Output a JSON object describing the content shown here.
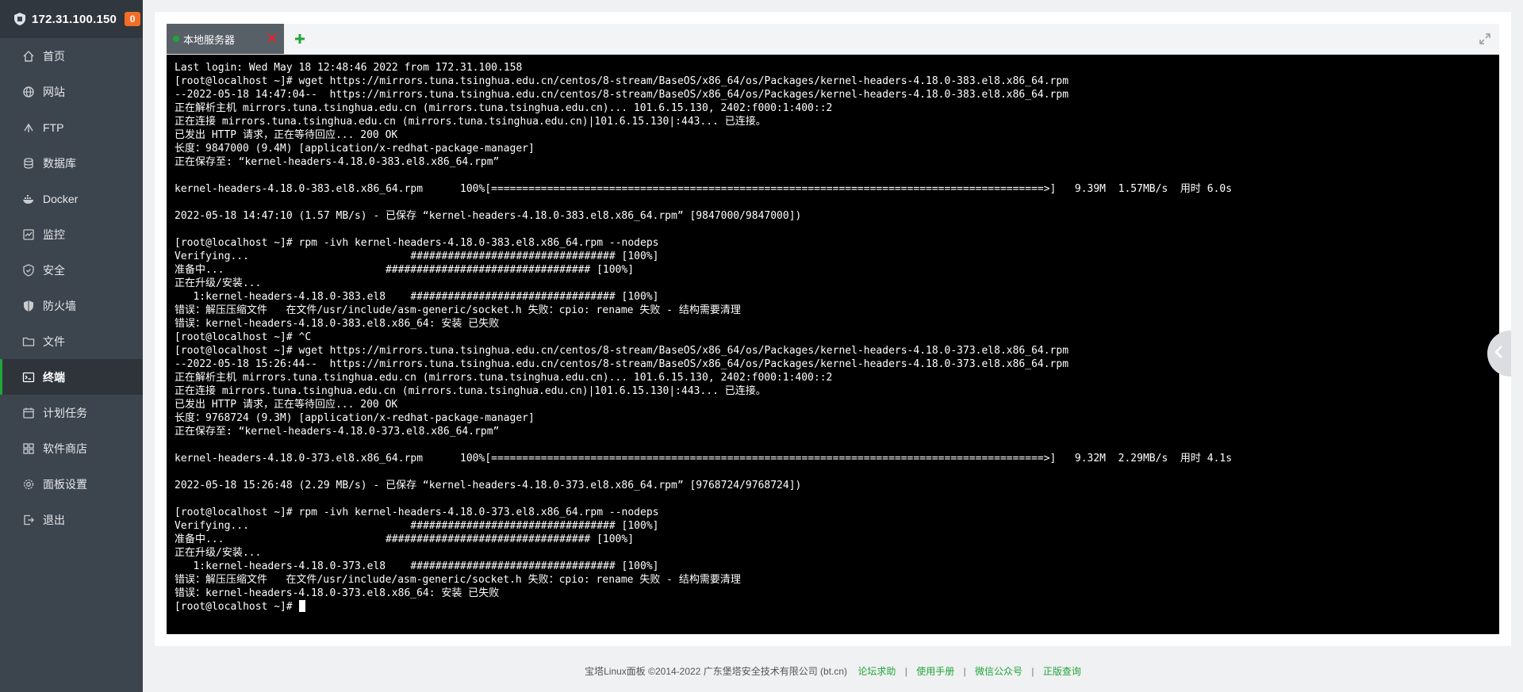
{
  "server": {
    "ip": "172.31.100.150",
    "notifications": "0"
  },
  "sidebar": {
    "items": [
      {
        "label": "首页",
        "icon": "home-icon",
        "active": false
      },
      {
        "label": "网站",
        "icon": "globe-icon",
        "active": false
      },
      {
        "label": "FTP",
        "icon": "ftp-icon",
        "active": false
      },
      {
        "label": "数据库",
        "icon": "database-icon",
        "active": false
      },
      {
        "label": "Docker",
        "icon": "docker-icon",
        "active": false
      },
      {
        "label": "监控",
        "icon": "monitor-icon",
        "active": false
      },
      {
        "label": "安全",
        "icon": "shield-check-icon",
        "active": false
      },
      {
        "label": "防火墙",
        "icon": "firewall-icon",
        "active": false
      },
      {
        "label": "文件",
        "icon": "folder-icon",
        "active": false
      },
      {
        "label": "终端",
        "icon": "terminal-icon",
        "active": true
      },
      {
        "label": "计划任务",
        "icon": "calendar-icon",
        "active": false
      },
      {
        "label": "软件商店",
        "icon": "apps-icon",
        "active": false
      },
      {
        "label": "面板设置",
        "icon": "gear-icon",
        "active": false
      },
      {
        "label": "退出",
        "icon": "logout-icon",
        "active": false
      }
    ]
  },
  "terminal": {
    "tab_label": "本地服务器",
    "lines": [
      "Last login: Wed May 18 12:48:46 2022 from 172.31.100.158",
      "[root@localhost ~]# wget https://mirrors.tuna.tsinghua.edu.cn/centos/8-stream/BaseOS/x86_64/os/Packages/kernel-headers-4.18.0-383.el8.x86_64.rpm",
      "--2022-05-18 14:47:04--  https://mirrors.tuna.tsinghua.edu.cn/centos/8-stream/BaseOS/x86_64/os/Packages/kernel-headers-4.18.0-383.el8.x86_64.rpm",
      "正在解析主机 mirrors.tuna.tsinghua.edu.cn (mirrors.tuna.tsinghua.edu.cn)... 101.6.15.130, 2402:f000:1:400::2",
      "正在连接 mirrors.tuna.tsinghua.edu.cn (mirrors.tuna.tsinghua.edu.cn)|101.6.15.130|:443... 已连接。",
      "已发出 HTTP 请求，正在等待回应... 200 OK",
      "长度：9847000 (9.4M) [application/x-redhat-package-manager]",
      "正在保存至: “kernel-headers-4.18.0-383.el8.x86_64.rpm”",
      "",
      "kernel-headers-4.18.0-383.el8.x86_64.rpm      100%[=========================================================================================>]   9.39M  1.57MB/s  用时 6.0s",
      "",
      "2022-05-18 14:47:10 (1.57 MB/s) - 已保存 “kernel-headers-4.18.0-383.el8.x86_64.rpm” [9847000/9847000])",
      "",
      "[root@localhost ~]# rpm -ivh kernel-headers-4.18.0-383.el8.x86_64.rpm --nodeps",
      "Verifying...                          ################################# [100%]",
      "准备中...                          ################################# [100%]",
      "正在升级/安装...",
      "   1:kernel-headers-4.18.0-383.el8    ################################# [100%]",
      "错误：解压压缩文件   在文件/usr/include/asm-generic/socket.h 失败：cpio: rename 失败 - 结构需要清理",
      "错误：kernel-headers-4.18.0-383.el8.x86_64: 安装 已失败",
      "[root@localhost ~]# ^C",
      "[root@localhost ~]# wget https://mirrors.tuna.tsinghua.edu.cn/centos/8-stream/BaseOS/x86_64/os/Packages/kernel-headers-4.18.0-373.el8.x86_64.rpm",
      "--2022-05-18 15:26:44--  https://mirrors.tuna.tsinghua.edu.cn/centos/8-stream/BaseOS/x86_64/os/Packages/kernel-headers-4.18.0-373.el8.x86_64.rpm",
      "正在解析主机 mirrors.tuna.tsinghua.edu.cn (mirrors.tuna.tsinghua.edu.cn)... 101.6.15.130, 2402:f000:1:400::2",
      "正在连接 mirrors.tuna.tsinghua.edu.cn (mirrors.tuna.tsinghua.edu.cn)|101.6.15.130|:443... 已连接。",
      "已发出 HTTP 请求，正在等待回应... 200 OK",
      "长度：9768724 (9.3M) [application/x-redhat-package-manager]",
      "正在保存至: “kernel-headers-4.18.0-373.el8.x86_64.rpm”",
      "",
      "kernel-headers-4.18.0-373.el8.x86_64.rpm      100%[=========================================================================================>]   9.32M  2.29MB/s  用时 4.1s",
      "",
      "2022-05-18 15:26:48 (2.29 MB/s) - 已保存 “kernel-headers-4.18.0-373.el8.x86_64.rpm” [9768724/9768724])",
      "",
      "[root@localhost ~]# rpm -ivh kernel-headers-4.18.0-373.el8.x86_64.rpm --nodeps",
      "Verifying...                          ################################# [100%]",
      "准备中...                          ################################# [100%]",
      "正在升级/安装...",
      "   1:kernel-headers-4.18.0-373.el8    ################################# [100%]",
      "错误：解压压缩文件   在文件/usr/include/asm-generic/socket.h 失败：cpio: rename 失败 - 结构需要清理",
      "错误：kernel-headers-4.18.0-373.el8.x86_64: 安装 已失败"
    ],
    "prompt": "[root@localhost ~]# "
  },
  "footer": {
    "copyright": "宝塔Linux面板 ©2014-2022 广东堡塔安全技术有限公司 (bt.cn)",
    "links": [
      "论坛求助",
      "使用手册",
      "微信公众号",
      "正版查询"
    ]
  },
  "colors": {
    "sidebar_bg": "#3c444d",
    "accent": "#20a53a",
    "badge": "#f36d27",
    "terminal_bg": "#000000"
  }
}
